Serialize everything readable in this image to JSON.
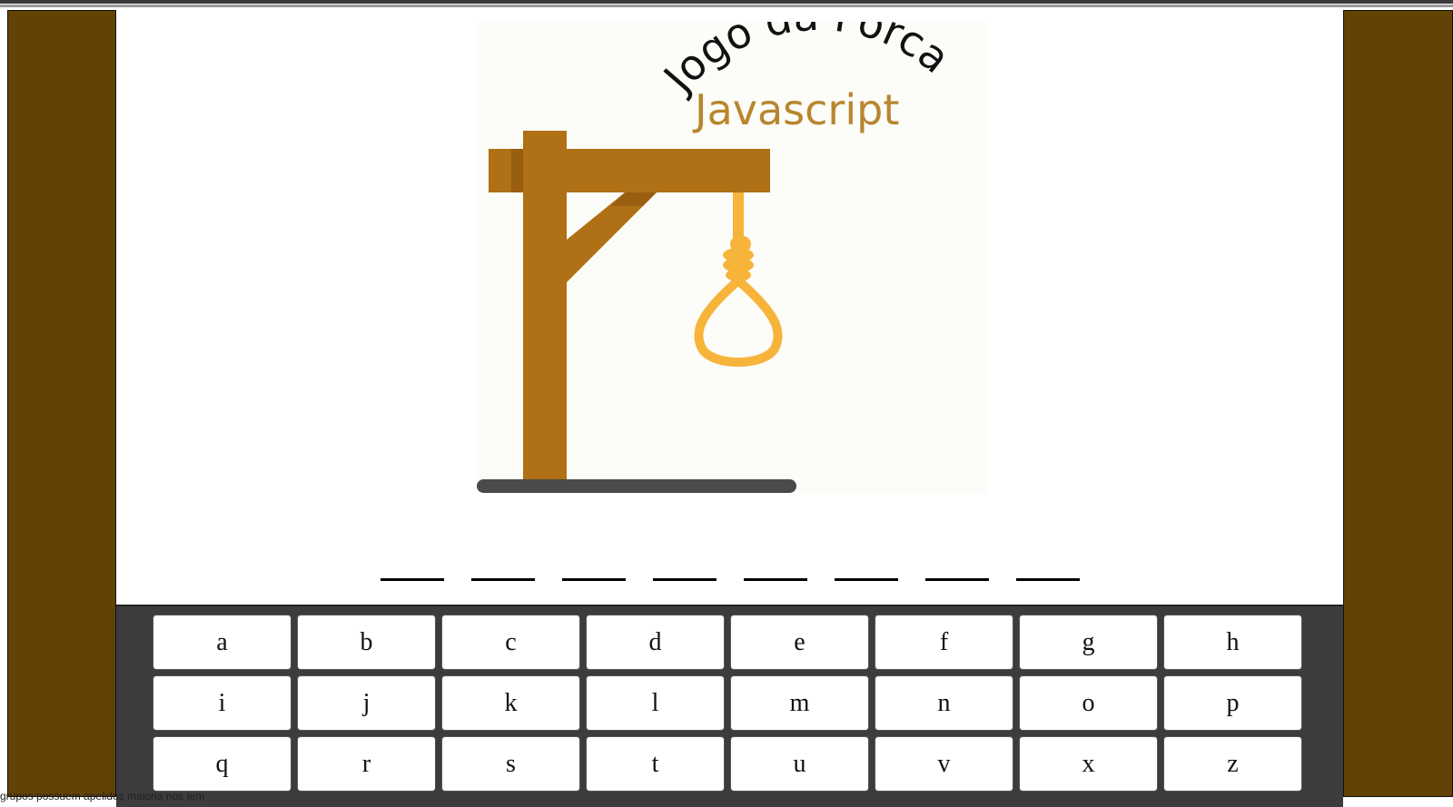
{
  "game": {
    "title": "Jogo da Forca",
    "subtitle": "Javascript",
    "word_length": 8,
    "slots": [
      "",
      "",
      "",
      "",
      "",
      "",
      "",
      ""
    ]
  },
  "keyboard": {
    "letters": [
      "a",
      "b",
      "c",
      "d",
      "e",
      "f",
      "g",
      "h",
      "i",
      "j",
      "k",
      "l",
      "m",
      "n",
      "o",
      "p",
      "q",
      "r",
      "s",
      "t",
      "u",
      "v",
      "x",
      "z"
    ]
  },
  "footer": {
    "text": "grupos possuem apelidos maioria nos tem"
  },
  "colors": {
    "side_panel": "#624205",
    "gallows_wood": "#b07015",
    "rope": "#f7b43a",
    "subtitle": "#b8862e",
    "keyboard_bg": "#3c3c3c",
    "ground": "#4a4a4a"
  }
}
